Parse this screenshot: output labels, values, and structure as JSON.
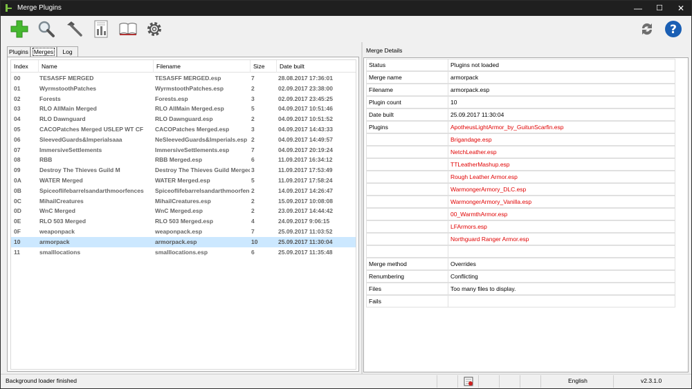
{
  "window": {
    "title": "Merge Plugins",
    "minimize": "—",
    "maximize": "☐",
    "close": "✕"
  },
  "toolbar": {
    "items": [
      {
        "name": "add-icon",
        "color": "#46b830"
      },
      {
        "name": "search-icon"
      },
      {
        "name": "hammer-icon"
      },
      {
        "name": "report-icon"
      },
      {
        "name": "book-icon"
      },
      {
        "name": "gear-icon"
      }
    ],
    "right": [
      {
        "name": "refresh-icon"
      },
      {
        "name": "help-icon",
        "color": "#1a5fb4"
      }
    ]
  },
  "tabs": [
    "Plugins",
    "Merges",
    "Log"
  ],
  "active_tab": "Merges",
  "merges": {
    "columns": [
      "Index",
      "Name",
      "Filename",
      "Size",
      "Date built"
    ],
    "rows": [
      [
        "00",
        "TESASFF MERGED",
        "TESASFF MERGED.esp",
        "7",
        "28.08.2017 17:36:01"
      ],
      [
        "01",
        "WyrmstoothPatches",
        "WyrmstoothPatches.esp",
        "2",
        "02.09.2017 23:38:00"
      ],
      [
        "02",
        "Forests",
        "Forests.esp",
        "3",
        "02.09.2017 23:45:25"
      ],
      [
        "03",
        "RLO AllMain Merged",
        "RLO AllMain Merged.esp",
        "5",
        "04.09.2017 10:51:46"
      ],
      [
        "04",
        "RLO Dawnguard",
        "RLO Dawnguard.esp",
        "2",
        "04.09.2017 10:51:52"
      ],
      [
        "05",
        "CACOPatches Merged USLEP WT CF",
        "CACOPatches Merged.esp",
        "3",
        "04.09.2017 14:43:33"
      ],
      [
        "06",
        "SleevedGuards&Imperialsaaa",
        "NeSleevedGuards&Imperials.esp",
        "2",
        "04.09.2017 14:49:57"
      ],
      [
        "07",
        "ImmersiveSettlements",
        "ImmersiveSettlements.esp",
        "7",
        "04.09.2017 20:19:24"
      ],
      [
        "08",
        "RBB",
        "RBB Merged.esp",
        "6",
        "11.09.2017 16:34:12"
      ],
      [
        "09",
        "Destroy The Thieves Guild M",
        "Destroy The Thieves Guild Merged.esp",
        "3",
        "11.09.2017 17:53:49"
      ],
      [
        "0A",
        "WATER Merged",
        "WATER Merged.esp",
        "5",
        "11.09.2017 17:58:24"
      ],
      [
        "0B",
        "Spiceoflifebarrelsandarthmoorfences",
        "Spiceoflifebarrelsandarthmoorfences.esp",
        "2",
        "14.09.2017 14:26:47"
      ],
      [
        "0C",
        "MihailCreatures",
        "MihailCreatures.esp",
        "2",
        "15.09.2017 10:08:08"
      ],
      [
        "0D",
        "WnC Merged",
        "WnC Merged.esp",
        "2",
        "23.09.2017 14:44:42"
      ],
      [
        "0E",
        "RLO 503 Merged",
        "RLO 503 Merged.esp",
        "4",
        "24.09.2017 9:06:15"
      ],
      [
        "0F",
        "weaponpack",
        "weaponpack.esp",
        "7",
        "25.09.2017 11:03:52"
      ],
      [
        "10",
        "armorpack",
        "armorpack.esp",
        "10",
        "25.09.2017 11:30:04"
      ],
      [
        "11",
        "smalllocations",
        "smalllocations.esp",
        "6",
        "25.09.2017 11:35:48"
      ]
    ],
    "selected_index": "10"
  },
  "details": {
    "title": "Merge Details",
    "rows": [
      {
        "label": "Status",
        "value": "Plugins not loaded"
      },
      {
        "label": "Merge name",
        "value": "armorpack"
      },
      {
        "label": "Filename",
        "value": "armorpack.esp"
      },
      {
        "label": "Plugin count",
        "value": "10"
      },
      {
        "label": "Date built",
        "value": "25.09.2017 11:30:04"
      },
      {
        "label": "Plugins",
        "value": "ApotheusLightArmor_by_GuitunScarfin.esp",
        "red": true
      },
      {
        "label": "",
        "value": "Brigandage.esp",
        "red": true
      },
      {
        "label": "",
        "value": "NetchLeather.esp",
        "red": true
      },
      {
        "label": "",
        "value": "TTLeatherMashup.esp",
        "red": true
      },
      {
        "label": "",
        "value": "Rough Leather Armor.esp",
        "red": true
      },
      {
        "label": "",
        "value": "WarmongerArmory_DLC.esp",
        "red": true
      },
      {
        "label": "",
        "value": "WarmongerArmory_Vanilla.esp",
        "red": true
      },
      {
        "label": "",
        "value": "00_WarmthArmor.esp",
        "red": true
      },
      {
        "label": "",
        "value": "LFArmors.esp",
        "red": true
      },
      {
        "label": "",
        "value": "Northguard Ranger Armor.esp",
        "red": true
      },
      {
        "label": "",
        "value": ""
      },
      {
        "label": "Merge method",
        "value": "Overrides"
      },
      {
        "label": "Renumbering",
        "value": "Conflicting"
      },
      {
        "label": "Files",
        "value": "Too many files to display."
      },
      {
        "label": "Fails",
        "value": ""
      }
    ]
  },
  "status": {
    "text": "Background loader finished",
    "language": "English",
    "version": "v2.3.1.0"
  }
}
